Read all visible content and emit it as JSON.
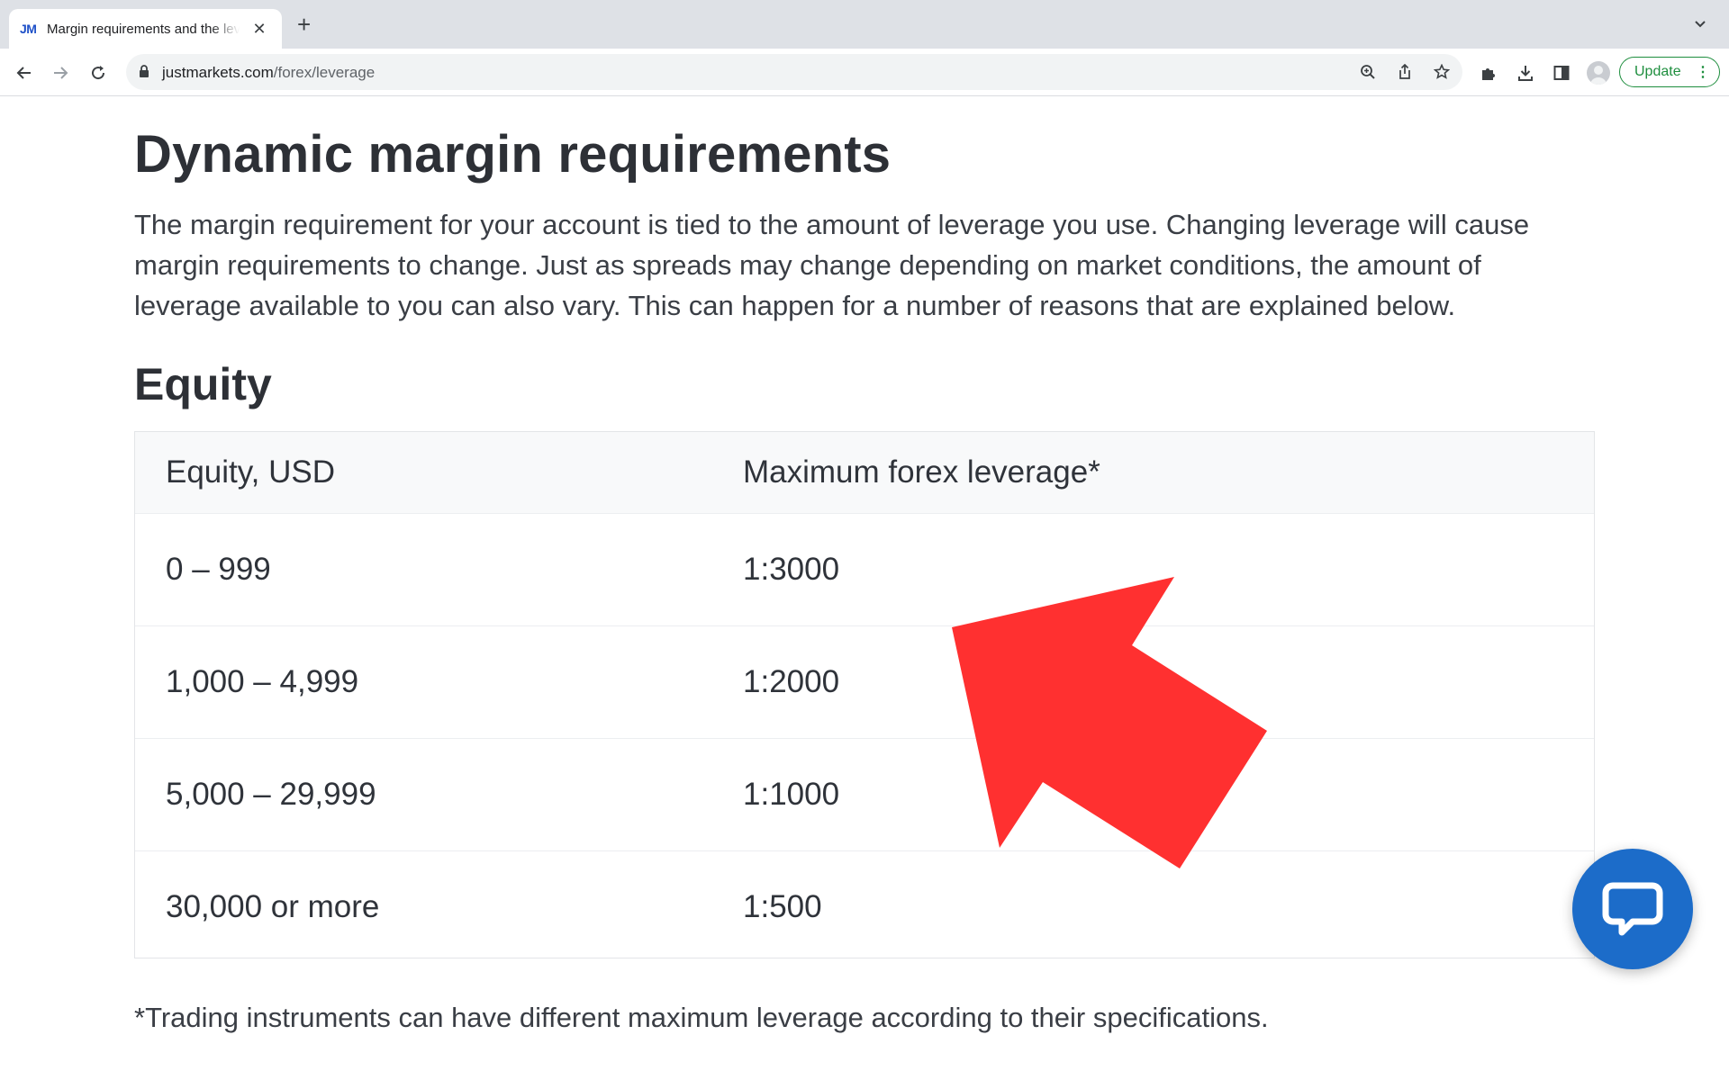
{
  "browser": {
    "tab": {
      "favicon_text": "JM",
      "title": "Margin requirements and the leverage",
      "close_icon": "close-icon"
    },
    "new_tab_icon": "plus-icon",
    "url": {
      "domain": "justmarkets.com",
      "path": "/forex/leverage"
    },
    "update_label": "Update",
    "update_menu": "⋮"
  },
  "page": {
    "title": "Dynamic margin requirements",
    "intro": "The margin requirement for your account is tied to the amount of leverage you use. Changing leverage will cause margin requirements to change. Just as spreads may change depending on market conditions, the amount of leverage available to you can also vary. This can happen for a number of reasons that are explained below.",
    "section_title": "Equity",
    "table": {
      "headers": [
        "Equity, USD",
        "Maximum forex leverage*"
      ],
      "rows": [
        [
          "0 – 999",
          "1:3000"
        ],
        [
          "1,000 – 4,999",
          "1:2000"
        ],
        [
          "5,000 – 29,999",
          "1:1000"
        ],
        [
          "30,000 or more",
          "1:500"
        ]
      ]
    },
    "footnote": "*Trading instruments can have different maximum leverage according to their specifications."
  },
  "colors": {
    "arrow": "#ff3030",
    "chat": "#1c6cc9",
    "update": "#1e8e3e"
  }
}
